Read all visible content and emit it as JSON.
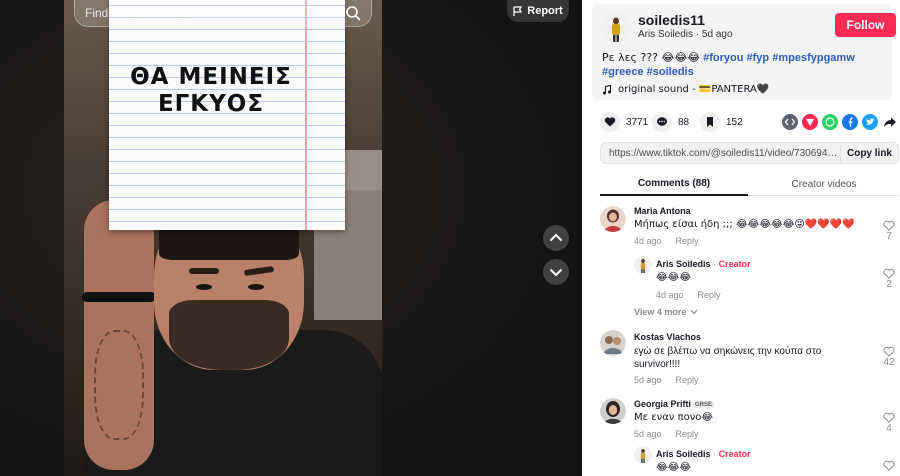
{
  "video": {
    "paper_line1": "ΘΑ ΜΕΙΝΕΙΣ",
    "paper_line2": "ΕΓΚΥΟΣ",
    "search_placeholder": "Find related content",
    "report_label": "Report"
  },
  "author": {
    "username": "soiledis11",
    "display_name": "Aris Soiledis",
    "time": "5d ago",
    "follow_label": "Follow"
  },
  "caption": {
    "text": "Ρε λες ??? 😂😂😂",
    "tags": [
      "#foryou",
      "#fyp",
      "#mpesfypgamw",
      "#greece",
      "#soiledis"
    ]
  },
  "sound": {
    "label": "original sound - 💳PANTERA🖤"
  },
  "stats": {
    "likes": "3771",
    "comments": "88",
    "saves": "152"
  },
  "share": {
    "colors": [
      "#5d6170",
      "#fe2c55",
      "#25d366",
      "#1877f2",
      "#1da1f2"
    ]
  },
  "link": {
    "url": "https://www.tiktok.com/@soiledis11/video/730694221...",
    "copy_label": "Copy link"
  },
  "tabs": {
    "comments": "Comments (88)",
    "creator": "Creator videos"
  },
  "comments": [
    {
      "name": "Maria Antona",
      "text": "Μήπως είσαι ήδη ;;; 😂😂😂😂😂😝❤️❤️❤️❤️",
      "time": "4d ago",
      "reply_label": "Reply",
      "likes": "7",
      "reply": {
        "name": "Aris Soiledis",
        "creator": "Creator",
        "sep": "·",
        "text": "😂😂😂",
        "time": "4d ago",
        "reply_label": "Reply",
        "likes": "2"
      },
      "view_more": "View 4 more"
    },
    {
      "name": "Kostas Vlachos",
      "text": "εγώ σε βλέπω να σηκώνεις την κούπα στο survivor!!!!",
      "time": "5d ago",
      "reply_label": "Reply",
      "likes": "42"
    },
    {
      "name": "Georgia Prifti",
      "badge": "GRSE",
      "text": "Με εναν πονο😂",
      "time": "5d ago",
      "reply_label": "Reply",
      "likes": "4",
      "reply": {
        "name": "Aris Soiledis",
        "creator": "Creator",
        "sep": "·",
        "text": "😂😂😂",
        "likes": ""
      }
    }
  ]
}
